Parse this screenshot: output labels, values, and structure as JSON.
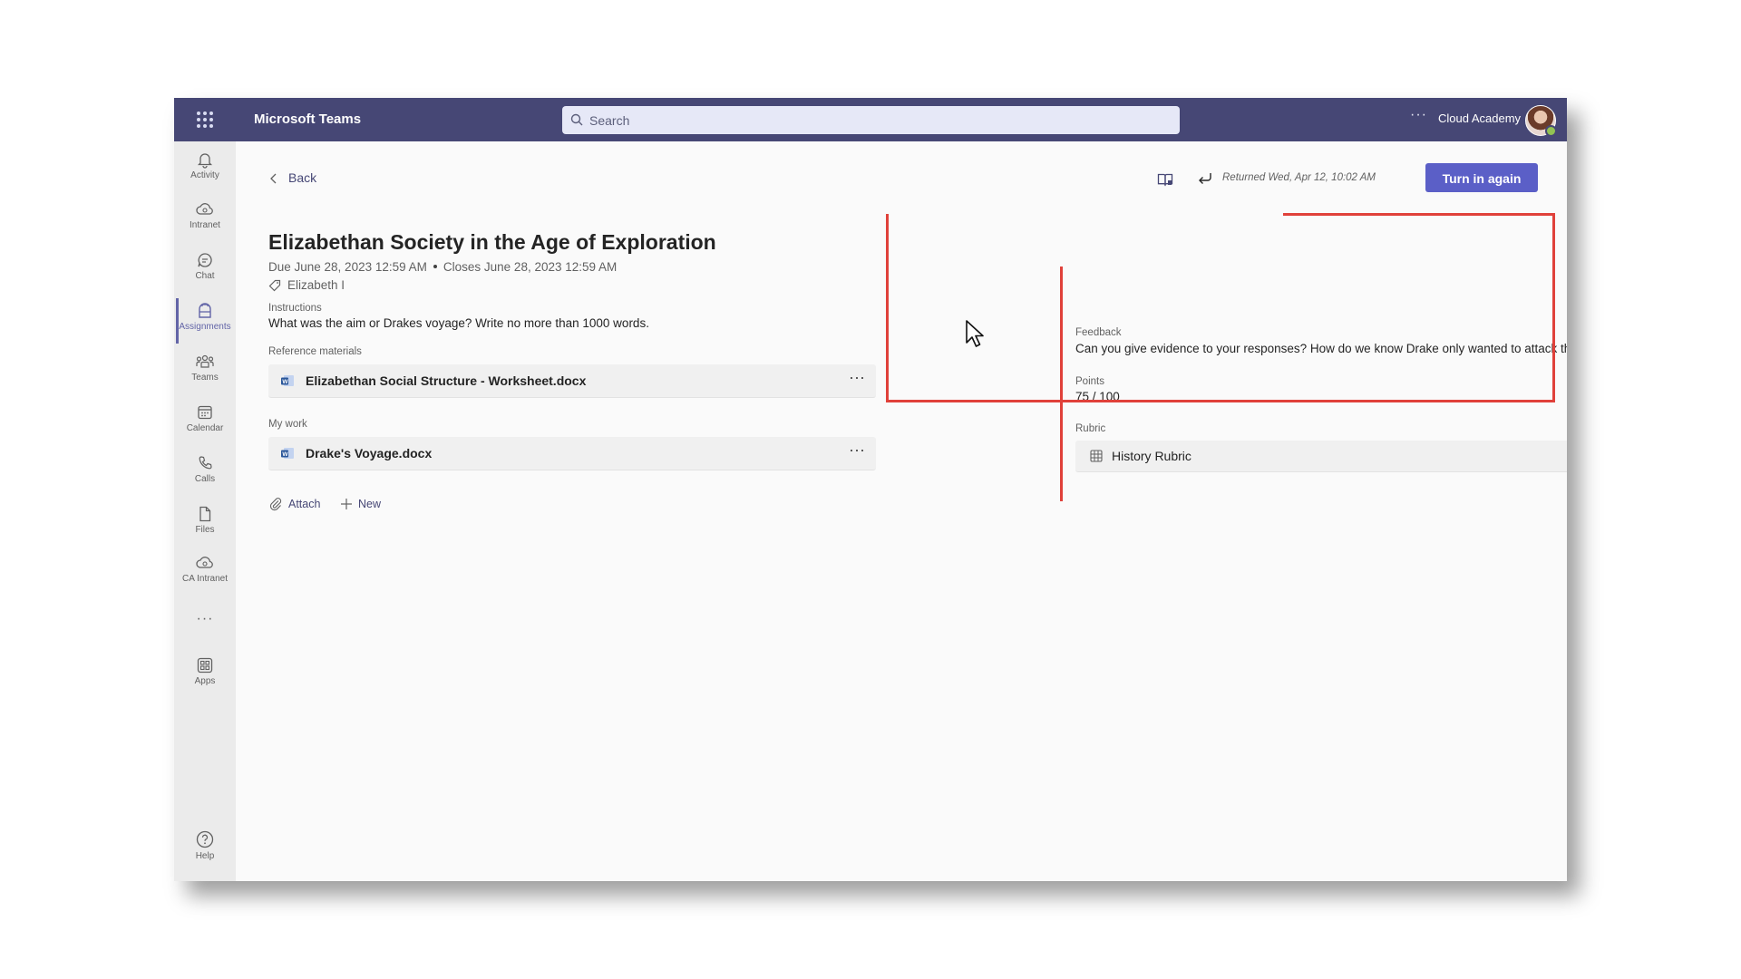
{
  "app": {
    "title": "Microsoft Teams"
  },
  "header": {
    "search_placeholder": "Search",
    "org_name": "Cloud Academy",
    "more": "···"
  },
  "rail": {
    "items": [
      {
        "label": "Activity",
        "icon": "bell-icon"
      },
      {
        "label": "Intranet",
        "icon": "cloud-icon"
      },
      {
        "label": "Chat",
        "icon": "chat-icon"
      },
      {
        "label": "Assignments",
        "icon": "assignments-icon",
        "active": true
      },
      {
        "label": "Teams",
        "icon": "teams-icon"
      },
      {
        "label": "Calendar",
        "icon": "calendar-icon"
      },
      {
        "label": "Calls",
        "icon": "phone-icon"
      },
      {
        "label": "Files",
        "icon": "file-icon"
      },
      {
        "label": "CA Intranet",
        "icon": "cloud-icon"
      },
      {
        "label": "Apps",
        "icon": "apps-icon"
      },
      {
        "label": "Help",
        "icon": "help-icon"
      }
    ],
    "more": "···"
  },
  "toolbar": {
    "back_label": "Back",
    "returned_text": "Returned Wed, Apr 12, 10:02 AM",
    "turn_in_label": "Turn in again"
  },
  "assignment": {
    "title": "Elizabethan Society in the Age of Exploration",
    "due": "Due June 28, 2023 12:59 AM",
    "closes": "Closes June 28, 2023 12:59 AM",
    "tag": "Elizabeth I",
    "instructions_label": "Instructions",
    "instructions_text": "What was the aim or Drakes voyage? Write no more than 1000 words.",
    "reference_label": "Reference materials",
    "reference_file": "Elizabethan Social Structure - Worksheet.docx",
    "mywork_label": "My work",
    "mywork_file": "Drake's Voyage.docx",
    "file_more": "···",
    "attach_label": "Attach",
    "new_label": "New"
  },
  "feedback": {
    "feedback_label": "Feedback",
    "feedback_text": "Can you give evidence to your responses? How do we know Drake only wanted to attack the Spanish?",
    "points_label": "Points",
    "points_value": "75 / 100",
    "rubric_label": "Rubric",
    "rubric_name": "History Rubric"
  },
  "colors": {
    "topbar": "#464775",
    "accent": "#5b5fc7",
    "highlight": "#e0413a"
  }
}
